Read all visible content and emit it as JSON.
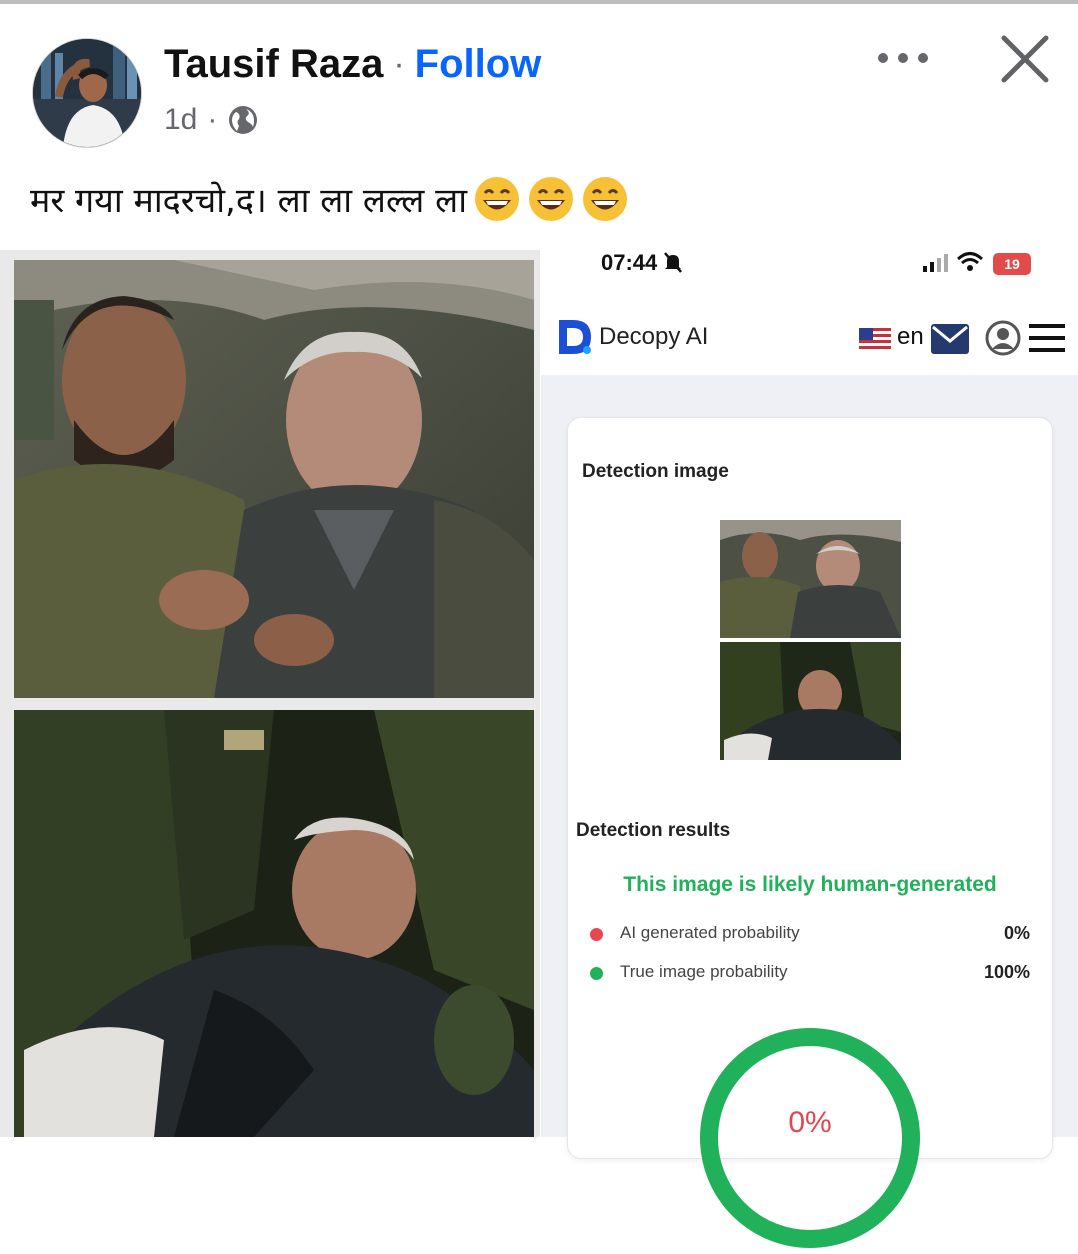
{
  "post": {
    "author": "Tausif Raza",
    "separator": "·",
    "follow_label": "Follow",
    "time": "1d",
    "meta_separator": "·",
    "audience_icon": "globe-icon",
    "caption": "मर गया मादरचो,द। ला ला लल्ल ला",
    "emojis": [
      "grinning-face-icon",
      "grinning-face-icon",
      "grinning-face-icon"
    ],
    "more_icon": "more-dots-icon",
    "close_icon": "close-icon"
  },
  "screenshot": {
    "status_time": "07:44",
    "battery": "19",
    "app_name": "Decopy AI",
    "language": "en",
    "detection_image_title": "Detection image",
    "detection_results_title": "Detection results",
    "verdict": "This image is likely human-generated",
    "rows": [
      {
        "label": "AI generated probability",
        "value": "0%",
        "color": "#e8474f"
      },
      {
        "label": "True image probability",
        "value": "100%",
        "color": "#21b15b"
      }
    ],
    "gauge_value": "0%",
    "gauge_fraction": 0,
    "accent_green": "#21b15b",
    "accent_red": "#e0484f"
  },
  "colors": {
    "follow": "#0866ff",
    "meta": "#65676b"
  }
}
